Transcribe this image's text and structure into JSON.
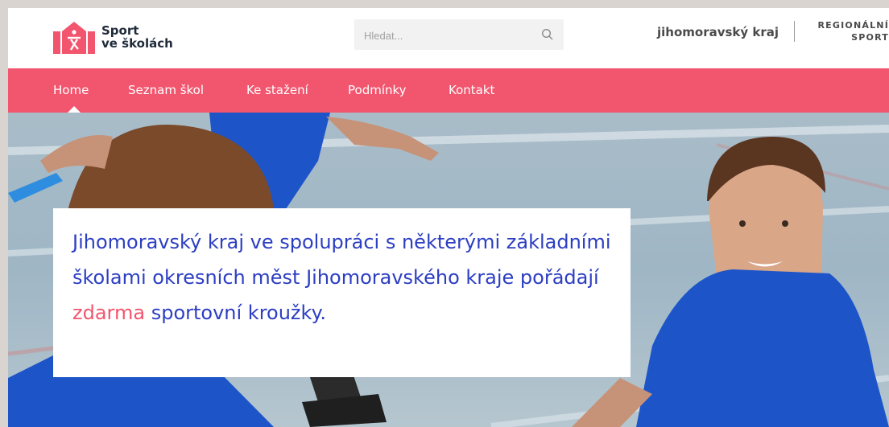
{
  "header": {
    "logo_line1": "Sport",
    "logo_line2": "ve školách",
    "search_placeholder": "Hledat...",
    "region_link": "jihomoravský kraj",
    "partner_logo_line1": "REGIONÁLNÍ",
    "partner_logo_line2": "SPORT"
  },
  "nav": {
    "items": [
      {
        "label": "Home"
      },
      {
        "label": "Seznam škol"
      },
      {
        "label": "Ke stažení"
      },
      {
        "label": "Podmínky"
      },
      {
        "label": "Kontakt"
      }
    ],
    "active_index": 0
  },
  "hero": {
    "text_before": "Jihomoravský kraj ve spolupráci s některými základními školami okresních měst Jihomoravského kraje pořádají ",
    "text_accent": "zdarma",
    "text_after": " sportovní kroužky."
  },
  "colors": {
    "brand_pink": "#f2556e",
    "hero_text_blue": "#2c3ec2",
    "logo_dark": "#1f2a3a"
  },
  "icons": {
    "search": "search-icon",
    "logo": "school-house-logo-icon"
  }
}
